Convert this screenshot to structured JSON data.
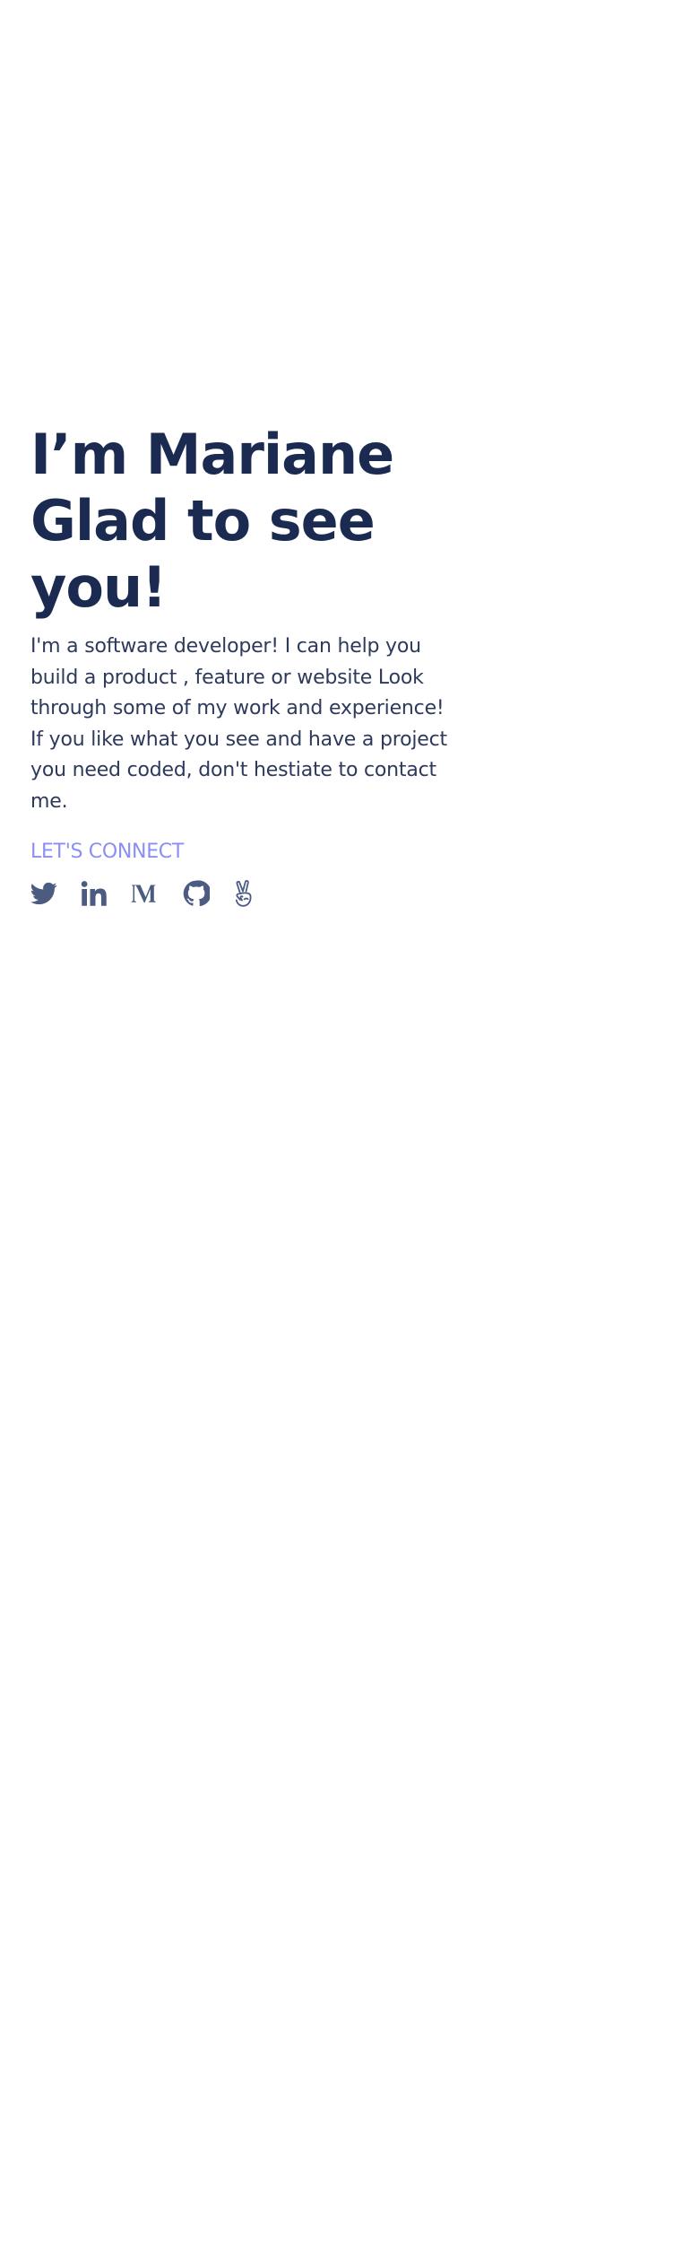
{
  "hero": {
    "heading_lines": [
      "I’m Mariane",
      "Glad to see",
      "you!"
    ],
    "intro": "I'm a software developer! I can help you build a product , feature or website Look through some of my work and experience! If you like what you see and have a project you need coded, don't hestiate to contact me.",
    "connect_label": "LET'S CONNECT"
  },
  "socials": [
    {
      "icon": "twitter-icon"
    },
    {
      "icon": "linkedin-icon"
    },
    {
      "icon": "medium-icon"
    },
    {
      "icon": "github-icon"
    },
    {
      "icon": "angellist-icon"
    }
  ],
  "colors": {
    "heading": "#1b2a50",
    "body_text": "#2e3a5c",
    "accent": "#8b8ff5",
    "icon": "#4c5c80",
    "background": "#ffffff"
  }
}
